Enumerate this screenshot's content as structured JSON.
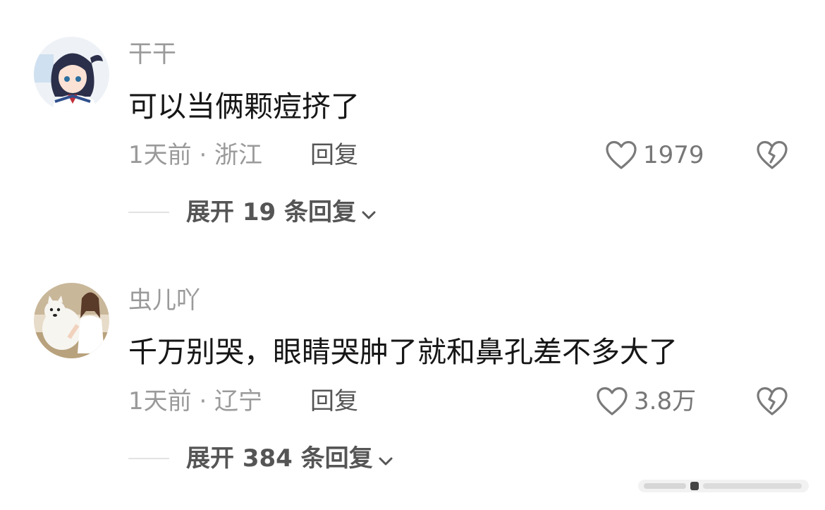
{
  "comments": [
    {
      "username": "干干",
      "text": "可以当俩颗痘挤了",
      "meta": "1天前 · 浙江",
      "reply_label": "回复",
      "likes": "1979",
      "expand_label": "展开 19 条回复",
      "avatar_icon": "anime-girl-avatar"
    },
    {
      "username": "虫儿吖",
      "text": "千万别哭，眼睛哭肿了就和鼻孔差不多大了",
      "meta": "1天前 · 辽宁",
      "reply_label": "回复",
      "likes": "3.8万",
      "expand_label": "展开 384 条回复",
      "avatar_icon": "girl-with-dog-avatar"
    }
  ],
  "colors": {
    "text": "#161616",
    "muted": "#9a9a9a",
    "secondary": "#555555"
  }
}
